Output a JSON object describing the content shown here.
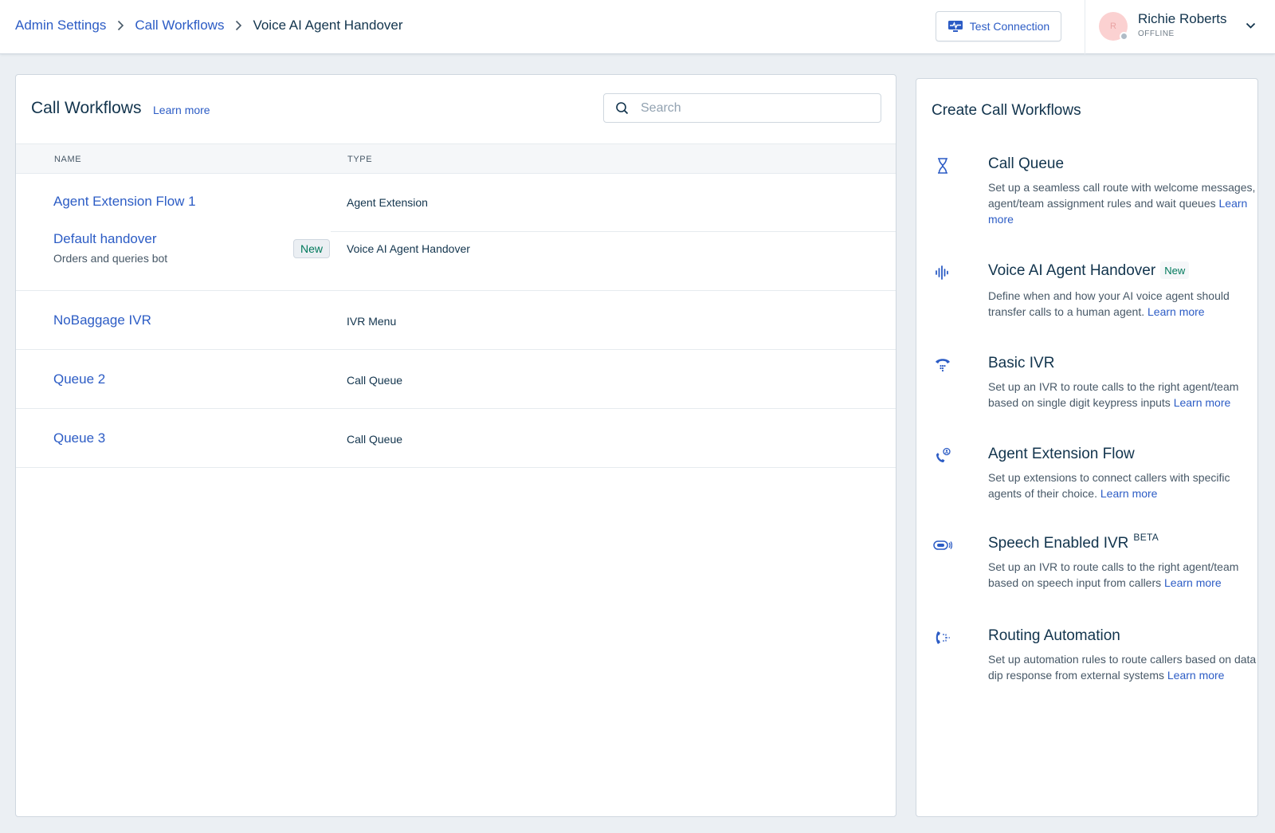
{
  "header": {
    "breadcrumbs": [
      "Admin Settings",
      "Call Workflows"
    ],
    "current": "Voice AI Agent Handover",
    "test_connection": "Test Connection",
    "user": {
      "name": "Richie Roberts",
      "status": "OFFLINE",
      "initials": "R"
    }
  },
  "workflows": {
    "title": "Call Workflows",
    "learn_more": "Learn more",
    "search_placeholder": "Search",
    "columns": {
      "name": "NAME",
      "type": "TYPE"
    },
    "rows": [
      {
        "name": "Agent Extension Flow 1",
        "type": "Agent Extension"
      },
      {
        "name": "Default handover",
        "subtitle": "Orders and queries bot",
        "badge": "New",
        "type": "Voice AI Agent Handover"
      },
      {
        "name": "NoBaggage IVR",
        "type": "IVR Menu"
      },
      {
        "name": "Queue 2",
        "type": "Call Queue"
      },
      {
        "name": "Queue 3",
        "type": "Call Queue"
      }
    ]
  },
  "create": {
    "title": "Create Call Workflows",
    "items": [
      {
        "icon": "hourglass-icon",
        "title": "Call Queue",
        "desc": "Set up a seamless call route with welcome messages, agent/team assignment rules and wait queues",
        "link": "Learn more"
      },
      {
        "icon": "voice-wave-icon",
        "title": "Voice AI Agent Handover",
        "badge": "New",
        "desc": "Define when and how your AI voice agent should transfer calls to a human agent.",
        "link": "Learn more"
      },
      {
        "icon": "phone-keypad-icon",
        "title": "Basic IVR",
        "desc": "Set up an IVR to route calls to the right agent/team based on single digit keypress inputs",
        "link": "Learn more"
      },
      {
        "icon": "phone-agent-icon",
        "title": "Agent Extension Flow",
        "desc": "Set up extensions to connect callers with specific agents of their choice.",
        "link": "Learn more"
      },
      {
        "icon": "speech-ivr-icon",
        "title": "Speech Enabled IVR",
        "superscript": "BETA",
        "desc": "Set up an IVR to route calls to the right agent/team based on speech input from callers",
        "link": "Learn more"
      },
      {
        "icon": "routing-icon",
        "title": "Routing Automation",
        "desc": "Set up automation rules to route callers based on data dip response from external systems",
        "link": "Learn more"
      }
    ]
  },
  "colors": {
    "link": "#2c5cc5",
    "text": "#12344d",
    "badge_text": "#00795b",
    "background": "#ebeff3"
  }
}
